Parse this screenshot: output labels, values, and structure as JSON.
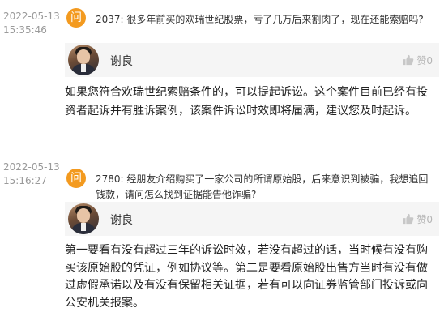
{
  "items": [
    {
      "date": "2022-05-13",
      "time": "15:35:46",
      "question_icon": "问",
      "question_label": "2037",
      "question": "很多年前买的欢瑞世纪股票，亏了几万后来割肉了，现在还能索赔吗?",
      "answerer": "谢良",
      "like_label": "赞0",
      "answer": "如果您符合欢瑞世纪索赔条件的，可以提起诉讼。这个案件目前已经有投资者起诉并有胜诉案例，该案件诉讼时效即将届满，建议您及时起诉。"
    },
    {
      "date": "2022-05-13",
      "time": "15:16:27",
      "question_icon": "问",
      "question_label": "2780",
      "question": "经朋友介绍购买了一家公司的所谓原始股，后来意识到被骗，我想追回钱款，请问怎么找到证据能告他诈骗?",
      "answerer": "谢良",
      "like_label": "赞0",
      "answer": "第一要看有没有超过三年的诉讼时效，若没有超过的话，当时候有没有购买该原始股的凭证，例如协议等。第二是要看原始股出售方当时有没有做过虚假承诺以及有没有保留相关证据，若有可以向证券监管部门投诉或向公安机关报案。"
    }
  ],
  "colors": {
    "accent": "#f39a1f",
    "meta": "#9a9a9a",
    "panel": "#f5f5f5"
  },
  "icons": {
    "question": "question-badge-icon",
    "like": "thumbs-up-icon",
    "avatar": "lawyer-avatar"
  }
}
